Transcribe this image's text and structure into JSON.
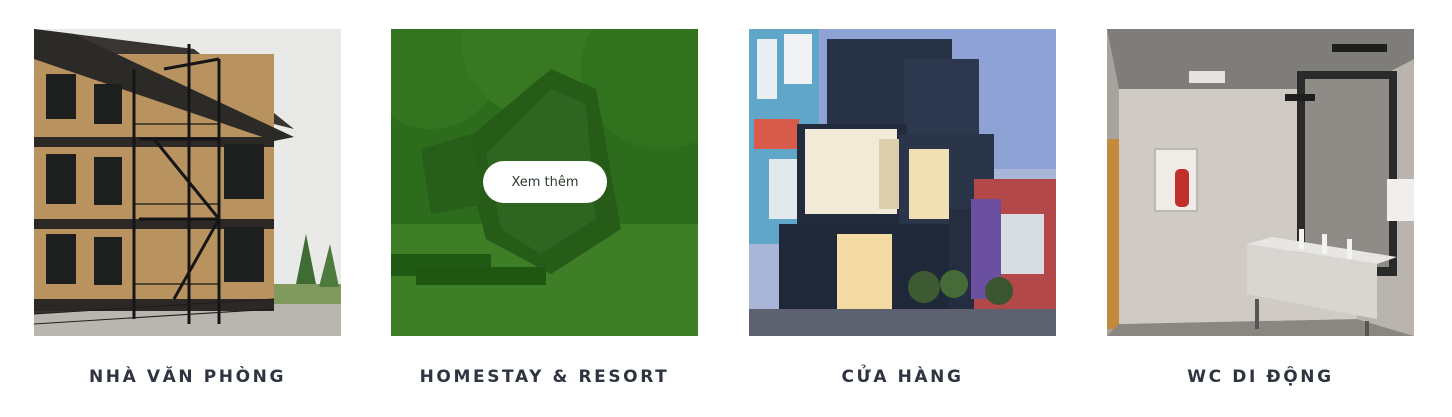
{
  "cards": [
    {
      "title": "NHÀ VĂN PHÒNG"
    },
    {
      "title": "HOMESTAY & RESORT",
      "hover_button": "Xem thêm"
    },
    {
      "title": "CỬA HÀNG"
    },
    {
      "title": "WC DI ĐỘNG"
    }
  ],
  "colors": {
    "caption": "#2e3440",
    "hover_overlay": "#1a6e08",
    "button_bg": "#ffffff"
  }
}
